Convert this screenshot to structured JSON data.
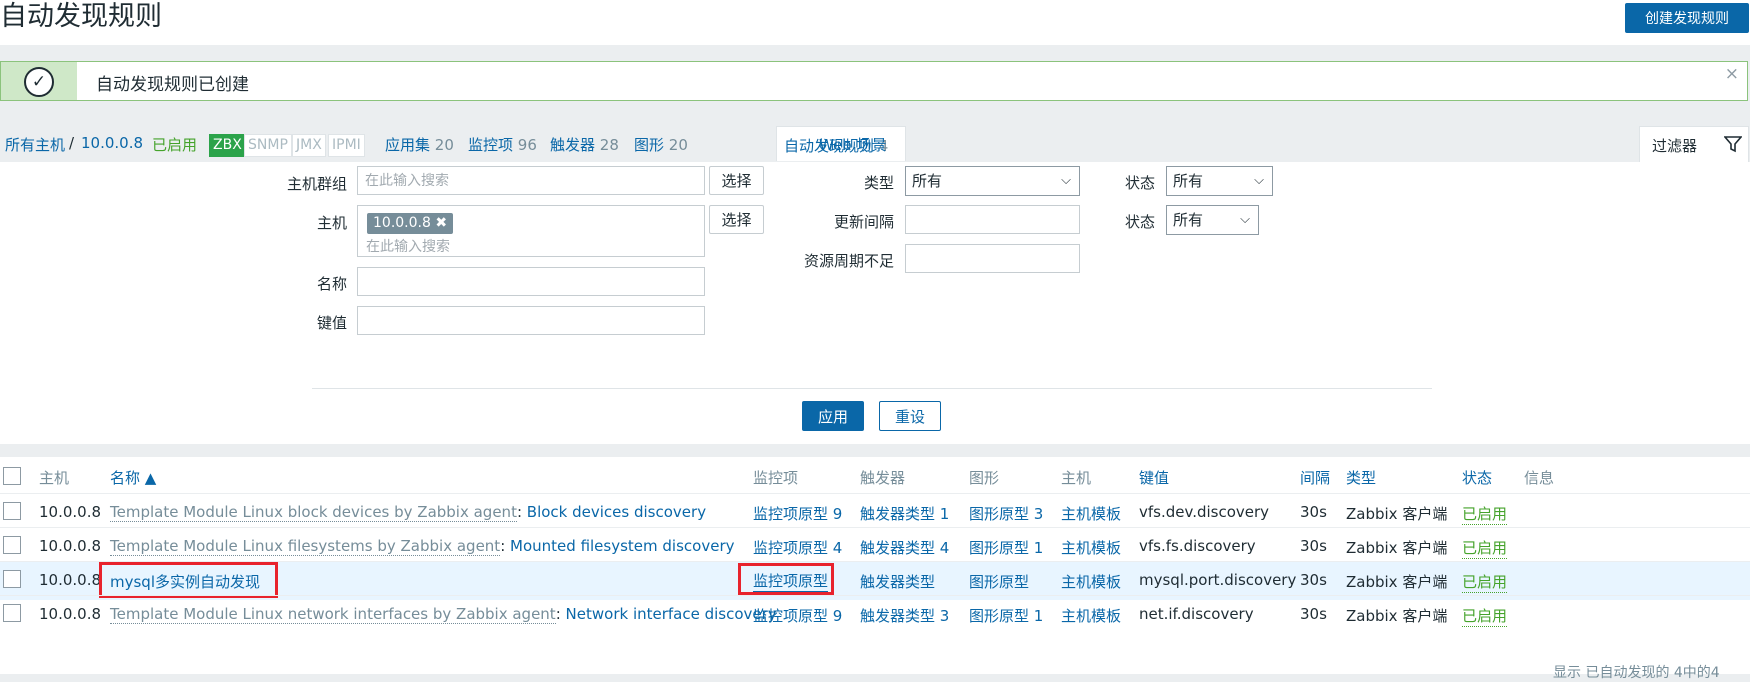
{
  "header": {
    "title": "自动发现规则",
    "create_button": "创建发现规则"
  },
  "message": {
    "text": "自动发现规则已创建",
    "close": "×"
  },
  "nav": {
    "all_hosts": "所有主机",
    "separator": "/",
    "host": "10.0.0.8",
    "status": "已启用",
    "tags": [
      "ZBX",
      "SNMP",
      "JMX",
      "IPMI"
    ],
    "items": [
      {
        "label": "应用集",
        "count": "20"
      },
      {
        "label": "监控项",
        "count": "96"
      },
      {
        "label": "触发器",
        "count": "28"
      },
      {
        "label": "图形",
        "count": "20"
      },
      {
        "label": "自动发现规则",
        "count": "4"
      },
      {
        "label": "Web 场景",
        "count": ""
      }
    ],
    "filter_tab": "过滤器"
  },
  "filter": {
    "host_group_label": "主机群组",
    "host_group_placeholder": "在此输入搜索",
    "select_label": "选择",
    "host_label": "主机",
    "host_chip": "10.0.0.8",
    "host_placeholder": "在此输入搜索",
    "name_label": "名称",
    "key_label": "键值",
    "type_label": "类型",
    "type_value": "所有",
    "interval_label": "更新间隔",
    "lifetime_label": "资源周期不足",
    "state_label": "状态",
    "state_value": "所有",
    "status_label": "状态",
    "status_value": "所有",
    "apply": "应用",
    "reset": "重设"
  },
  "table": {
    "headers": {
      "host": "主机",
      "name": "名称 ▲",
      "items": "监控项",
      "triggers": "触发器",
      "graphs": "图形",
      "hosts": "主机",
      "key": "键值",
      "interval": "间隔",
      "type": "类型",
      "status": "状态",
      "info": "信息"
    },
    "rows": [
      {
        "host": "10.0.0.8",
        "template": "Template Module Linux block devices by Zabbix agent",
        "sep": ":",
        "name": "Block devices discovery",
        "items": "监控项原型 9",
        "triggers": "触发器类型 1",
        "graphs": "图形原型 3",
        "hosts": "主机模板",
        "key": "vfs.dev.discovery",
        "interval": "30s",
        "type": "Zabbix 客户端",
        "status": "已启用"
      },
      {
        "host": "10.0.0.8",
        "template": "Template Module Linux filesystems by Zabbix agent",
        "sep": ":",
        "name": "Mounted filesystem discovery",
        "items": "监控项原型 4",
        "triggers": "触发器类型 4",
        "graphs": "图形原型 1",
        "hosts": "主机模板",
        "key": "vfs.fs.discovery",
        "interval": "30s",
        "type": "Zabbix 客户端",
        "status": "已启用"
      },
      {
        "host": "10.0.0.8",
        "template": "",
        "sep": "",
        "name": "mysql多实例自动发现",
        "items": "监控项原型",
        "triggers": "触发器类型",
        "graphs": "图形原型",
        "hosts": "主机模板",
        "key": "mysql.port.discovery",
        "interval": "30s",
        "type": "Zabbix 客户端",
        "status": "已启用"
      },
      {
        "host": "10.0.0.8",
        "template": "Template Module Linux network interfaces by Zabbix agent",
        "sep": ":",
        "name": "Network interface discovery",
        "items": "监控项原型 9",
        "triggers": "触发器类型 3",
        "graphs": "图形原型 1",
        "hosts": "主机模板",
        "key": "net.if.discovery",
        "interval": "30s",
        "type": "Zabbix 客户端",
        "status": "已启用"
      }
    ],
    "footer": "显示 已自动发现的 4中的4"
  }
}
